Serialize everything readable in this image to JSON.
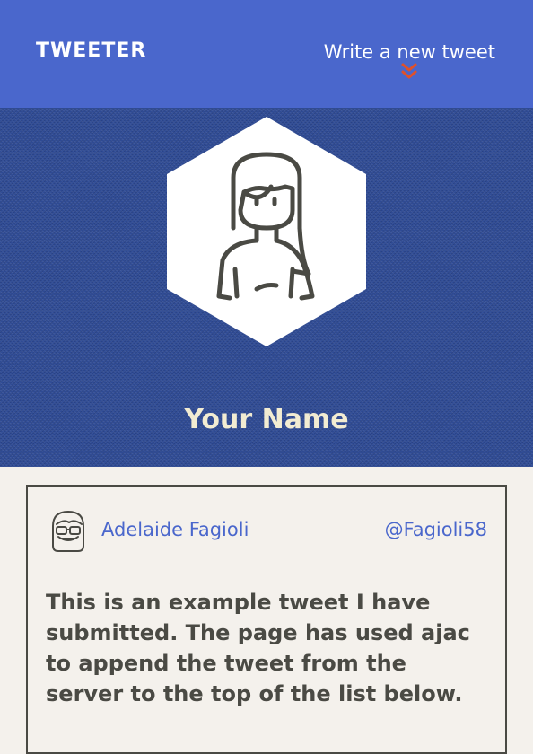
{
  "nav": {
    "logo": "TWEETER",
    "compose_label": "Write a new tweet",
    "compose_icon": "double-chevron-down-icon",
    "colors": {
      "background": "#4a67cc",
      "accent": "#e0512a"
    }
  },
  "profile": {
    "name": "Your Name",
    "avatar_icon": "woman-avatar-icon",
    "colors": {
      "background": "#2e4a94",
      "name_text": "#f2ecd2"
    }
  },
  "tweets": [
    {
      "avatar_icon": "girl-with-glasses-avatar-icon",
      "author": "Adelaide Fagioli",
      "handle": "@Fagioli58",
      "text": "This is an example tweet I have submitted. The page has used ajac to append the tweet from the server to the top of the list below."
    }
  ]
}
